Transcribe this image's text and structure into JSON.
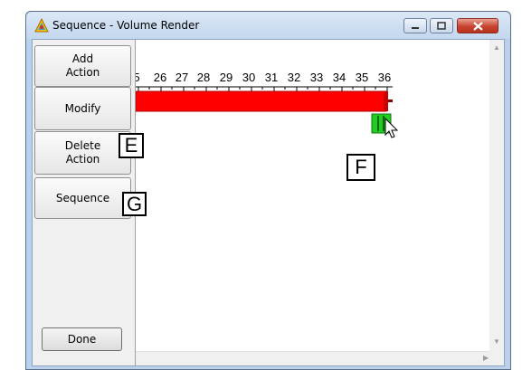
{
  "window": {
    "title": "Sequence - Volume Render",
    "controls": [
      "minimize-icon",
      "maximize-icon",
      "close-icon"
    ]
  },
  "sidebar": {
    "buttons": [
      {
        "label": "Add\nAction"
      },
      {
        "label": "Modify"
      },
      {
        "label": "Delete\nAction"
      },
      {
        "label": "Sequence"
      }
    ],
    "done_label": "Done"
  },
  "timeline": {
    "tick_labels": [
      "5",
      "26",
      "27",
      "28",
      "29",
      "30",
      "31",
      "32",
      "33",
      "34",
      "35",
      "36"
    ],
    "action_bar_color": "#ff0000",
    "keyframe_color": "#00cc00"
  },
  "callouts": {
    "e": "E",
    "f": "F",
    "g": "G"
  }
}
